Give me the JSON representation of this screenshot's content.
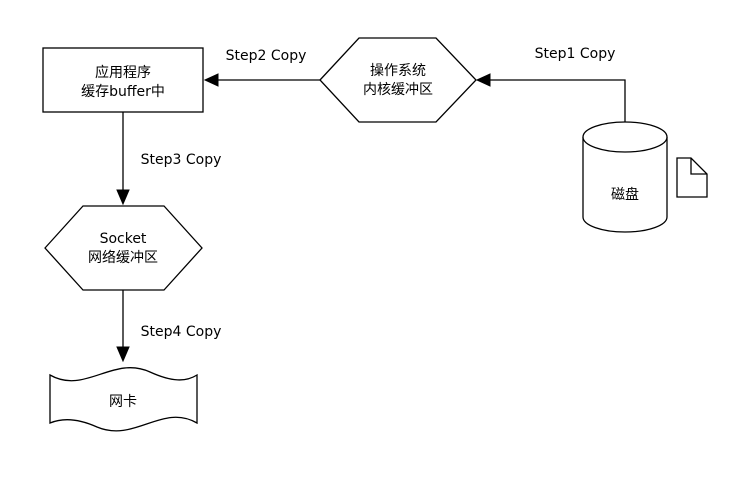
{
  "nodes": {
    "app_buffer": {
      "lines": [
        "应用程序",
        "缓存buffer中"
      ]
    },
    "os_buffer": {
      "lines": [
        "操作系统",
        "内核缓冲区"
      ]
    },
    "disk": {
      "label": "磁盘"
    },
    "socket_buffer": {
      "lines": [
        "Socket",
        "网络缓冲区"
      ]
    },
    "nic": {
      "label": "网卡"
    }
  },
  "edges": {
    "step1": {
      "label": "Step1 Copy"
    },
    "step2": {
      "label": "Step2 Copy"
    },
    "step3": {
      "label": "Step3 Copy"
    },
    "step4": {
      "label": "Step4 Copy"
    }
  },
  "icons": {
    "disk_file": "document-icon"
  }
}
